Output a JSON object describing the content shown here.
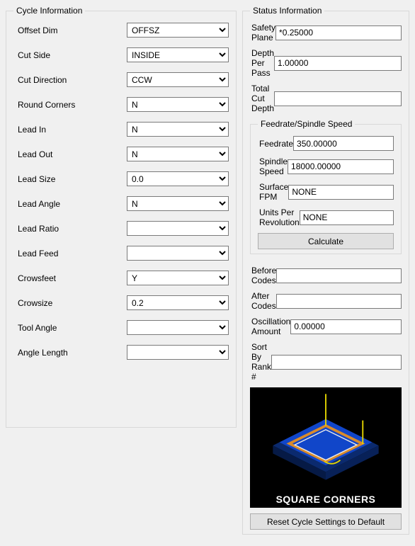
{
  "cycle": {
    "legend": "Cycle Information",
    "fields": [
      {
        "label": "Offset Dim",
        "value": "OFFSZ"
      },
      {
        "label": "Cut Side",
        "value": "INSIDE"
      },
      {
        "label": "Cut Direction",
        "value": "CCW"
      },
      {
        "label": "Round Corners",
        "value": "N"
      },
      {
        "label": "Lead In",
        "value": "N"
      },
      {
        "label": "Lead Out",
        "value": "N"
      },
      {
        "label": "Lead Size",
        "value": "0.0"
      },
      {
        "label": "Lead Angle",
        "value": "N"
      },
      {
        "label": "Lead Ratio",
        "value": ""
      },
      {
        "label": "Lead Feed",
        "value": ""
      },
      {
        "label": "Crowsfeet",
        "value": "Y"
      },
      {
        "label": "Crowsize",
        "value": "0.2"
      },
      {
        "label": "Tool Angle",
        "value": ""
      },
      {
        "label": "Angle Length",
        "value": ""
      }
    ]
  },
  "status": {
    "legend": "Status Information",
    "safety_plane": {
      "label": "Safety Plane",
      "value": "*0.25000"
    },
    "depth_per_pass": {
      "label": "Depth Per Pass",
      "value": "1.00000"
    },
    "total_cut_depth": {
      "label": "Total Cut Depth",
      "value": ""
    },
    "feed": {
      "legend": "Feedrate/Spindle Speed",
      "feedrate": {
        "label": "Feedrate",
        "value": "350.00000"
      },
      "spindle_speed": {
        "label": "Spindle Speed",
        "value": "18000.00000"
      },
      "surface_fpm": {
        "label": "Surface FPM",
        "value": "NONE"
      },
      "upr": {
        "label": "Units Per Revolution",
        "value": "NONE"
      },
      "calculate": "Calculate"
    },
    "before_codes": {
      "label": "Before Codes",
      "value": ""
    },
    "after_codes": {
      "label": "After Codes",
      "value": ""
    },
    "oscillation": {
      "label": "Oscillation Amount",
      "value": "0.00000"
    },
    "sort_rank": {
      "label": "Sort By Rank #",
      "value": ""
    },
    "preview_caption": "SQUARE CORNERS",
    "reset": "Reset Cycle Settings to Default"
  }
}
